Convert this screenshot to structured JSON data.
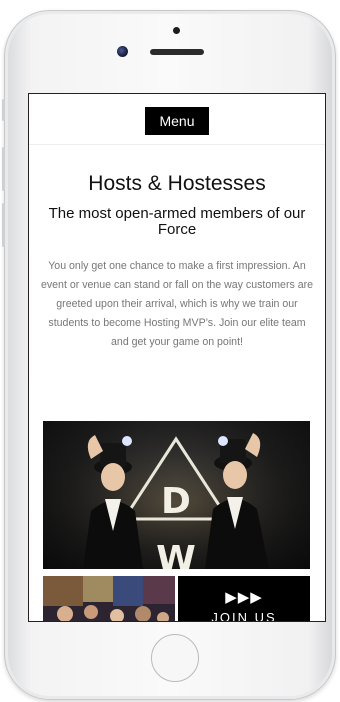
{
  "header": {
    "menu_label": "Menu"
  },
  "main": {
    "title": "Hosts & Hostesses",
    "subtitle": "The most open-armed members of our Force",
    "body": "You only get one chance to make a first impression. An event or venue can stand or fall on the way customers are greeted upon their arrival, which is why we train our students to become Hosting MVP’s. Join our elite team and get your game on point!"
  },
  "hero": {
    "logo_letters": [
      "D",
      "W"
    ]
  },
  "cta": {
    "play_label": "▶▶▶",
    "join_label": "JOIN US"
  }
}
